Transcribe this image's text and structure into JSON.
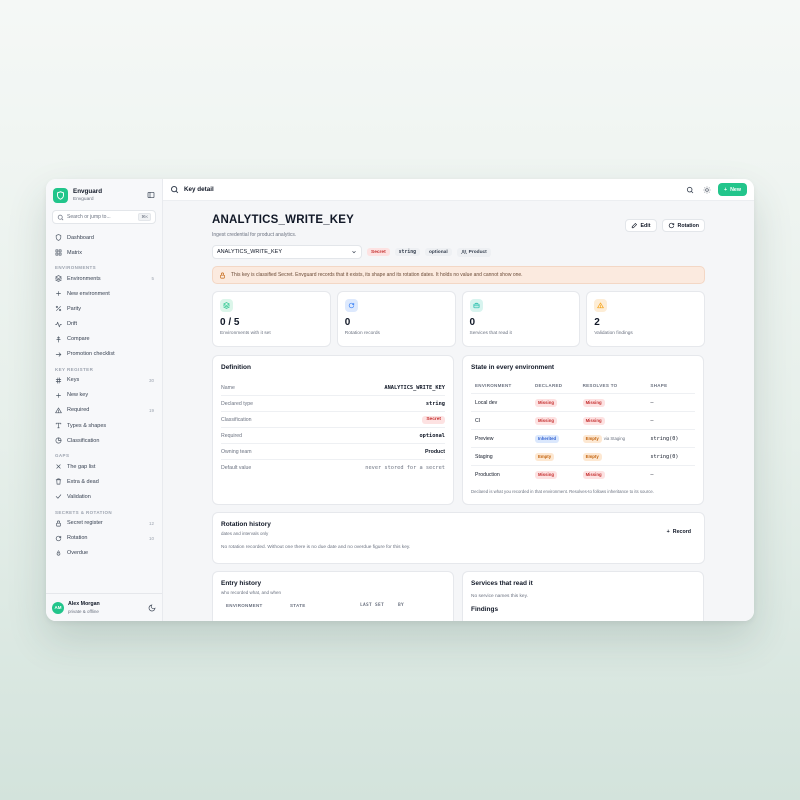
{
  "brand": {
    "name": "Envguard",
    "sub": "Envguard"
  },
  "search": {
    "placeholder": "Search or jump to...",
    "shortcut": "⌘K"
  },
  "sidebar": {
    "top": [
      {
        "label": "Dashboard",
        "icon": "shield-icon"
      },
      {
        "label": "Matrix",
        "icon": "grid-icon"
      }
    ],
    "sections": [
      {
        "title": "ENVIRONMENTS",
        "items": [
          {
            "label": "Environments",
            "count": "5",
            "icon": "layers-icon"
          },
          {
            "label": "New environment",
            "count": "",
            "icon": "plus-icon"
          },
          {
            "label": "Parity",
            "count": "",
            "icon": "percent-icon"
          },
          {
            "label": "Drift",
            "count": "",
            "icon": "activity-icon"
          },
          {
            "label": "Compare",
            "count": "",
            "icon": "compare-icon"
          },
          {
            "label": "Promotion checklist",
            "count": "",
            "icon": "arrow-right-icon"
          }
        ]
      },
      {
        "title": "KEY REGISTER",
        "items": [
          {
            "label": "Keys",
            "count": "30",
            "icon": "hash-icon"
          },
          {
            "label": "New key",
            "count": "",
            "icon": "plus-icon"
          },
          {
            "label": "Required",
            "count": "19",
            "icon": "warning-icon"
          },
          {
            "label": "Types & shapes",
            "count": "",
            "icon": "type-icon"
          },
          {
            "label": "Classification",
            "count": "",
            "icon": "pie-icon"
          }
        ]
      },
      {
        "title": "GAPS",
        "items": [
          {
            "label": "The gap list",
            "count": "",
            "icon": "x-icon"
          },
          {
            "label": "Extra & dead",
            "count": "",
            "icon": "trash-icon"
          },
          {
            "label": "Validation",
            "count": "",
            "icon": "check-icon"
          }
        ]
      },
      {
        "title": "SECRETS & ROTATION",
        "items": [
          {
            "label": "Secret register",
            "count": "12",
            "icon": "lock-icon"
          },
          {
            "label": "Rotation",
            "count": "10",
            "icon": "refresh-icon"
          },
          {
            "label": "Overdue",
            "count": "",
            "icon": "flame-icon"
          }
        ]
      }
    ]
  },
  "user": {
    "initials": "AM",
    "name": "Alex Morgan",
    "sub": "private & offline"
  },
  "topbar": {
    "title": "Key detail",
    "new_label": "New"
  },
  "key": {
    "name": "ANALYTICS_WRITE_KEY",
    "description": "Ingest credential for product analytics.",
    "edit_label": "Edit",
    "rotation_label": "Rotation",
    "select_value": "ANALYTICS_WRITE_KEY",
    "tags": {
      "classification": "Secret",
      "type": "string",
      "required": "optional",
      "team": "Product"
    }
  },
  "notice": "This key is classified Secret. Envguard records that it exists, its shape and its rotation dates. It holds no value and cannot show one.",
  "stats": [
    {
      "value": "0 / 5",
      "label": "Environments with it set",
      "icon": "layers-icon",
      "color": "#22c58b",
      "bg": "#dcf6ea"
    },
    {
      "value": "0",
      "label": "Rotation records",
      "icon": "refresh-icon",
      "color": "#3b82f6",
      "bg": "#dde9fd"
    },
    {
      "value": "0",
      "label": "Services that read it",
      "icon": "briefcase-icon",
      "color": "#14b8a6",
      "bg": "#d8f4ef"
    },
    {
      "value": "2",
      "label": "Validation findings",
      "icon": "warning-icon",
      "color": "#f59e0b",
      "bg": "#fdedd6"
    }
  ],
  "definition": {
    "title": "Definition",
    "rows": [
      {
        "k": "Name",
        "v": "ANALYTICS_WRITE_KEY"
      },
      {
        "k": "Declared type",
        "v": "string"
      },
      {
        "k": "Classification",
        "v": "Secret"
      },
      {
        "k": "Required",
        "v": "optional"
      },
      {
        "k": "Owning team",
        "v": "Product"
      },
      {
        "k": "Default value",
        "v": "never stored for a secret"
      }
    ]
  },
  "state": {
    "title": "State in every environment",
    "headers": [
      "ENVIRONMENT",
      "DECLARED",
      "RESOLVES TO",
      "SHAPE"
    ],
    "rows": [
      {
        "env": "Local dev",
        "declared": "Missing",
        "resolves": "Missing",
        "via": "",
        "shape": "–"
      },
      {
        "env": "CI",
        "declared": "Missing",
        "resolves": "Missing",
        "via": "",
        "shape": "–"
      },
      {
        "env": "Preview",
        "declared": "Inherited",
        "resolves": "Empty",
        "via": "via Staging",
        "shape": "string(0)"
      },
      {
        "env": "Staging",
        "declared": "Empty",
        "resolves": "Empty",
        "via": "",
        "shape": "string(0)"
      },
      {
        "env": "Production",
        "declared": "Missing",
        "resolves": "Missing",
        "via": "",
        "shape": "–"
      }
    ],
    "footnote": "Declared is what you recorded in that environment. Resolves-to follows inheritance to its source."
  },
  "rotation": {
    "title": "Rotation history",
    "sub": "dates and intervals only",
    "record_label": "Record",
    "empty": "No rotation recorded. Without one there is no due date and no overdue figure for this key."
  },
  "entry": {
    "title": "Entry history",
    "sub": "who recorded what, and when",
    "headers": [
      "ENVIRONMENT",
      "STATE",
      "LAST SET",
      "BY"
    ]
  },
  "services": {
    "title": "Services that read it",
    "empty": "No service names this key.",
    "findings_title": "Findings"
  }
}
